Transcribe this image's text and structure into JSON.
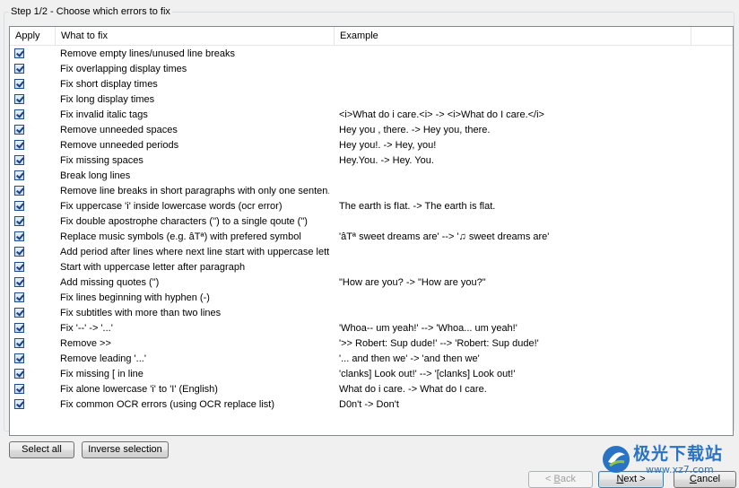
{
  "group": {
    "title": "Step 1/2 - Choose which errors to fix"
  },
  "columns": {
    "apply": "Apply",
    "what": "What to fix",
    "example": "Example"
  },
  "rows": [
    {
      "checked": true,
      "what": "Remove empty lines/unused line breaks",
      "example": ""
    },
    {
      "checked": true,
      "what": "Fix overlapping display times",
      "example": ""
    },
    {
      "checked": true,
      "what": "Fix short display times",
      "example": ""
    },
    {
      "checked": true,
      "what": "Fix long display times",
      "example": ""
    },
    {
      "checked": true,
      "what": "Fix invalid italic tags",
      "example": "<i>What do i care.<i> -> <i>What do I care.</i>"
    },
    {
      "checked": true,
      "what": "Remove unneeded spaces",
      "example": "Hey   you , there. -> Hey you, there."
    },
    {
      "checked": true,
      "what": "Remove unneeded periods",
      "example": "Hey you!. -> Hey, you!"
    },
    {
      "checked": true,
      "what": "Fix missing spaces",
      "example": "Hey.You. -> Hey. You."
    },
    {
      "checked": true,
      "what": "Break long lines",
      "example": ""
    },
    {
      "checked": true,
      "what": "Remove line breaks in short paragraphs with only one senten...",
      "example": ""
    },
    {
      "checked": true,
      "what": "Fix uppercase 'i' inside lowercase words (ocr error)",
      "example": "The earth is fIat. -> The earth is flat."
    },
    {
      "checked": true,
      "what": "Fix double apostrophe characters ('') to a single qoute (\")",
      "example": ""
    },
    {
      "checked": true,
      "what": "Replace music symbols (e.g. âTª) with prefered symbol",
      "example": "'âTª sweet dreams are' --> '♫ sweet dreams are'"
    },
    {
      "checked": true,
      "what": "Add period after lines where next line start with uppercase letter",
      "example": ""
    },
    {
      "checked": true,
      "what": "Start with uppercase letter after paragraph",
      "example": ""
    },
    {
      "checked": true,
      "what": "Add missing quotes (\")",
      "example": "\"How are you? -> \"How are you?\""
    },
    {
      "checked": true,
      "what": "Fix lines beginning with hyphen (-)",
      "example": ""
    },
    {
      "checked": true,
      "what": "Fix subtitles with more than two lines",
      "example": ""
    },
    {
      "checked": true,
      "what": "Fix '--' -> '...'",
      "example": "'Whoa-- um yeah!' --> 'Whoa... um yeah!'"
    },
    {
      "checked": true,
      "what": "Remove >>",
      "example": "'>> Robert: Sup dude!' --> 'Robert: Sup dude!'"
    },
    {
      "checked": true,
      "what": "Remove leading '...'",
      "example": "'... and then we' -> 'and then we'"
    },
    {
      "checked": true,
      "what": "Fix missing [ in line",
      "example": "'clanks] Look out!' --> '[clanks] Look out!'"
    },
    {
      "checked": true,
      "what": "Fix alone lowercase 'i' to 'I' (English)",
      "example": "What do i care. -> What do I care."
    },
    {
      "checked": true,
      "what": "Fix common OCR errors (using OCR replace list)",
      "example": "D0n't -> Don't"
    }
  ],
  "buttons": {
    "select_all": "Select all",
    "inverse_selection": "Inverse selection",
    "back": "< Back",
    "next": "Next >",
    "cancel": "Cancel"
  },
  "watermark": {
    "text": "极光下载站",
    "url": "www.xz7.com",
    "color": "#2a73c4"
  }
}
